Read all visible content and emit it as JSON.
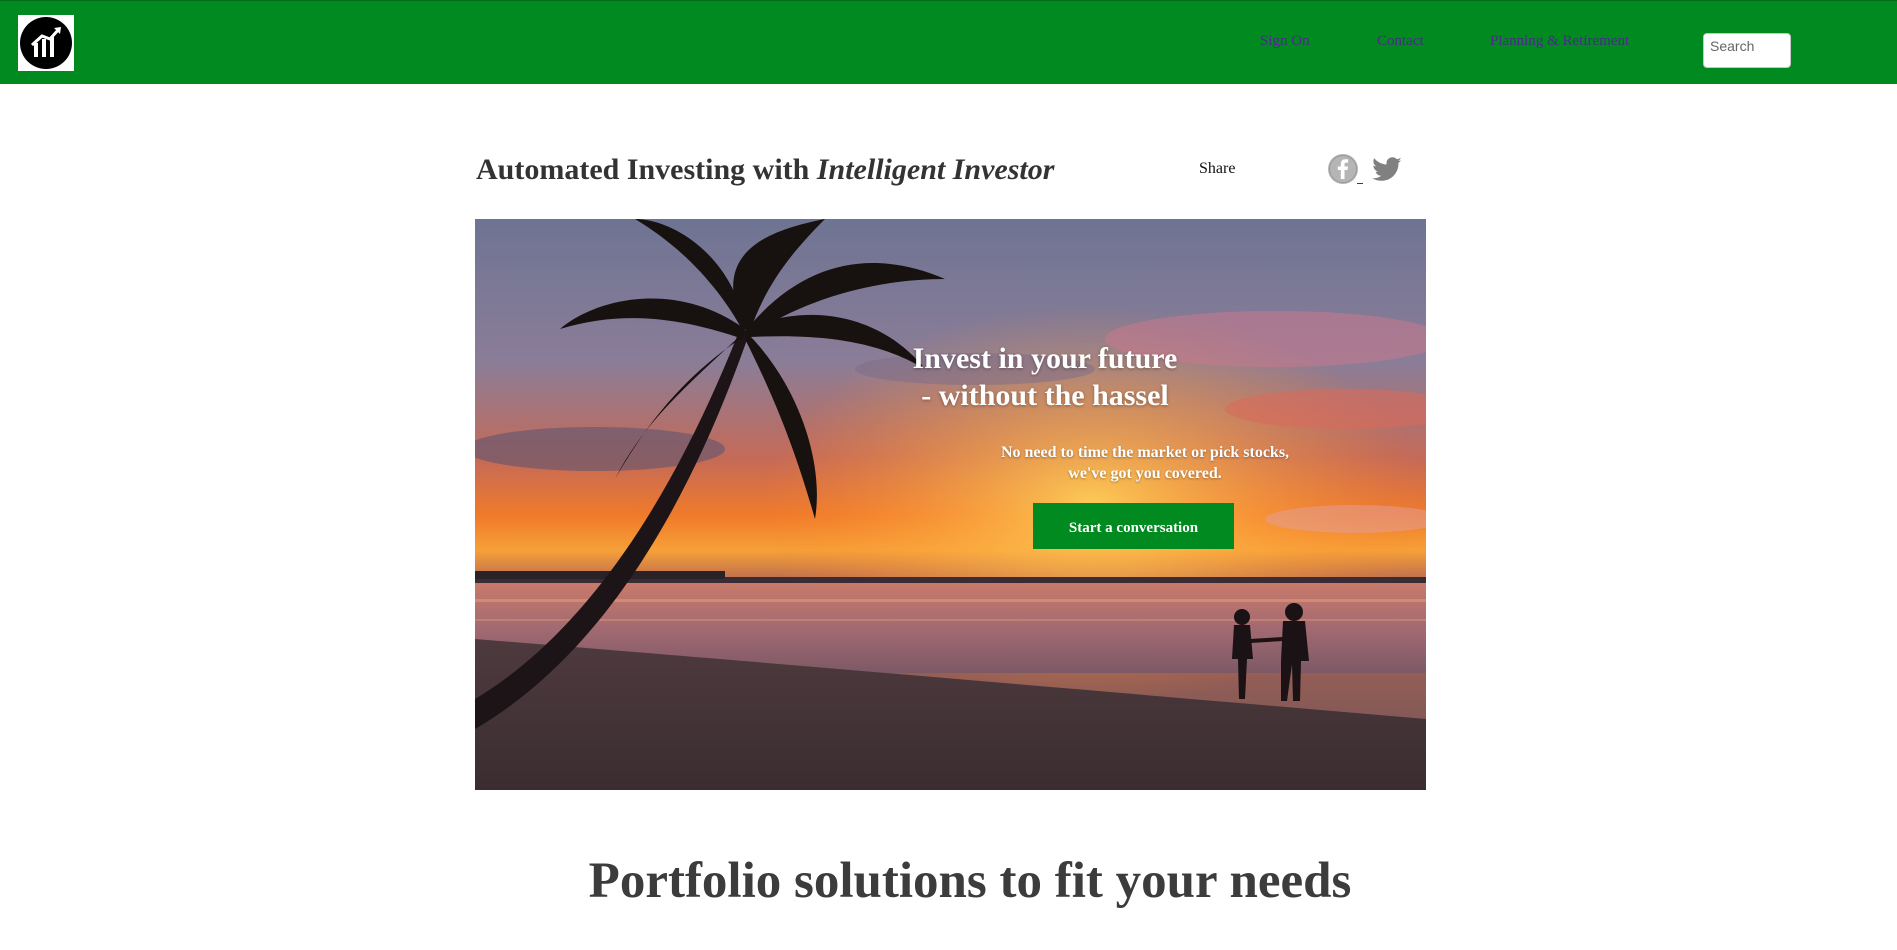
{
  "nav": {
    "links": [
      "Sign On",
      "Contact",
      "Planning & Retirement"
    ],
    "search_placeholder": "Search"
  },
  "header": {
    "title_prefix": "Automated Investing with ",
    "title_emphasis": "Intelligent Investor",
    "share_label": "Share"
  },
  "hero": {
    "title_line1": "Invest in your future",
    "title_line2": "- without the hassel",
    "subtitle_line1": "No need to time the market or pick stocks,",
    "subtitle_line2": "we've got you covered.",
    "cta_label": "Start a conversation"
  },
  "section": {
    "heading": "Portfolio solutions to fit your needs"
  },
  "colors": {
    "brand_green": "#008a1f",
    "nav_link": "#4b2a8a",
    "heading_text": "#333333"
  },
  "icons": [
    "growth-chart-logo-icon",
    "facebook-icon",
    "twitter-icon"
  ]
}
